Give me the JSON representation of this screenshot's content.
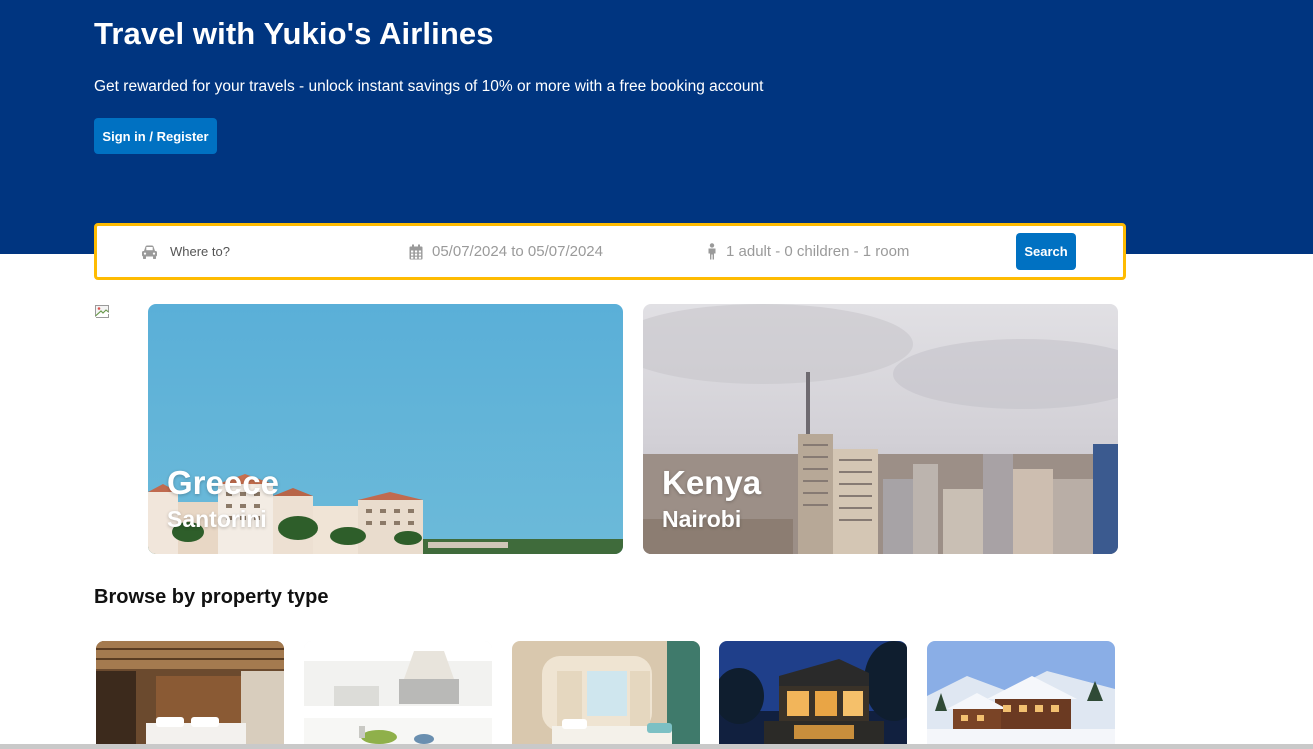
{
  "header": {
    "title": "Travel with Yukio's Airlines",
    "subtitle": "Get rewarded for your travels - unlock instant savings of 10% or more with a free booking account",
    "signin_label": "Sign in / Register"
  },
  "search": {
    "destination_placeholder": "Where to?",
    "dates": "05/07/2024 to 05/07/2024",
    "guests": "1 adult - 0 children - 1 room",
    "button_label": "Search"
  },
  "featured": [
    {
      "country": "Greece",
      "city": "Santorini"
    },
    {
      "country": "Kenya",
      "city": "Nairobi"
    }
  ],
  "property_section": {
    "title": "Browse by property type"
  },
  "property_types": [
    "hotel-room",
    "apartment-kitchen",
    "resort-suite",
    "villa",
    "chalet"
  ],
  "colors": {
    "brand_blue": "#003580",
    "button_blue": "#0071c2",
    "search_border": "#febb02"
  }
}
